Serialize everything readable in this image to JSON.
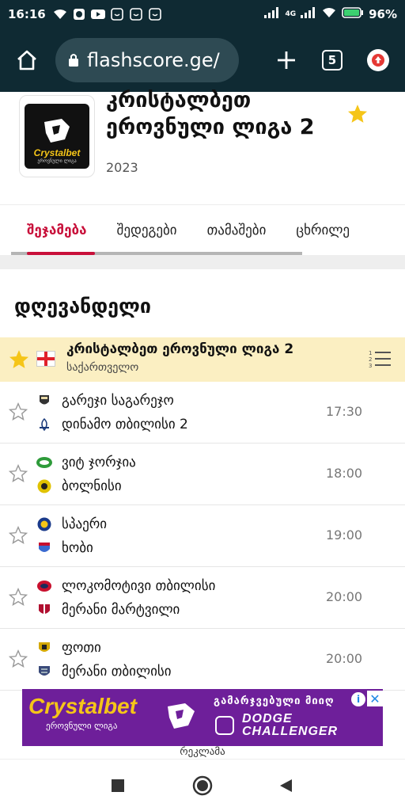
{
  "status_bar": {
    "time": "16:16",
    "battery": "96%",
    "network": "4G"
  },
  "browser": {
    "url": "flashscore.ge/",
    "tab_count": "5"
  },
  "league": {
    "title": "კრისტალბეთ ეროვნული ლიგა 2",
    "year": "2023",
    "logo_text": "Crystalbet",
    "logo_subtext": "ეროვნული ლიგა"
  },
  "tabs": [
    {
      "label": "შეჯამება",
      "active": true
    },
    {
      "label": "შედეგები",
      "active": false
    },
    {
      "label": "თამაშები",
      "active": false
    },
    {
      "label": "ცხრილე",
      "active": false
    }
  ],
  "section_title": "დღევანდელი",
  "league_row": {
    "name": "კრისტალბეთ ეროვნული ლიგა 2",
    "country": "საქართველო"
  },
  "matches": [
    {
      "home": "გარეჯი საგარეჯო",
      "away": "დინამო თბილისი 2",
      "time": "17:30",
      "home_color": "#333333",
      "away_color": "#1a3a7a"
    },
    {
      "home": "ვიტ ჯორჯია",
      "away": "ბოლნისი",
      "time": "18:00",
      "home_color": "#2e9b3a",
      "away_color": "#e0c200"
    },
    {
      "home": "სპაერი",
      "away": "ხობი",
      "time": "19:00",
      "home_color": "#1a3a8a",
      "away_color": "#3a6ad0"
    },
    {
      "home": "ლოკომოტივი თბილისი",
      "away": "მერანი მარტვილი",
      "time": "20:00",
      "home_color": "#c8102e",
      "away_color": "#b01030"
    },
    {
      "home": "ფოთი",
      "away": "მერანი თბილისი",
      "time": "20:00",
      "home_color": "#d4a800",
      "away_color": "#3a4a7a"
    }
  ],
  "ad": {
    "brand": "Crystalbet",
    "brand_sub": "ეროვნული ლიგა",
    "promo": "გამარჯვებული მიიღ",
    "dodge_line1": "DODGE",
    "dodge_line2": "CHALLENGER",
    "label": "რეკლამა"
  },
  "colors": {
    "accent": "#c8103a",
    "header_bg": "#0f2a33",
    "league_row_bg": "#fbefc2",
    "star_yellow": "#f5c518"
  }
}
